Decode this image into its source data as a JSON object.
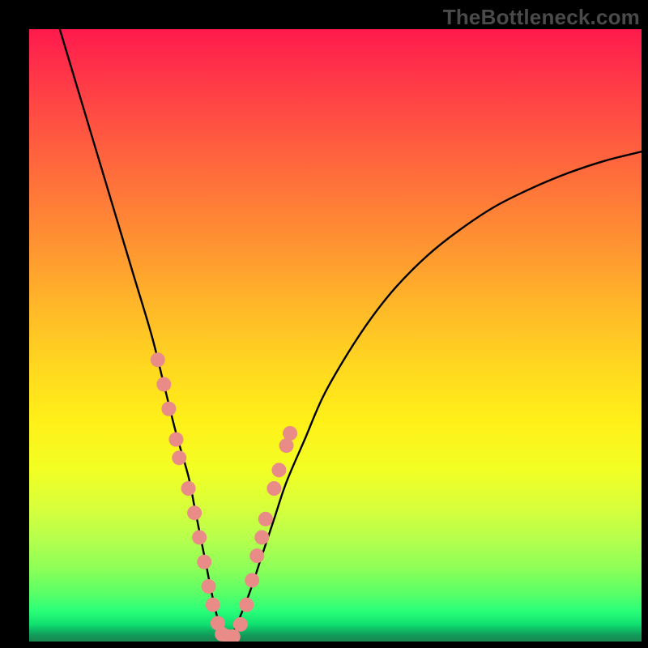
{
  "watermark": "TheBottleneck.com",
  "chart_data": {
    "type": "line",
    "title": "",
    "xlabel": "",
    "ylabel": "",
    "xlim": [
      0,
      100
    ],
    "ylim": [
      0,
      100
    ],
    "grid": false,
    "legend": false,
    "series": [
      {
        "name": "bottleneck-curve",
        "x": [
          5,
          8,
          11,
          14,
          17,
          20,
          22,
          24,
          26,
          27,
          28,
          29,
          30,
          31,
          32,
          33,
          34,
          36,
          38,
          40,
          42,
          45,
          48,
          52,
          56,
          60,
          65,
          70,
          76,
          82,
          88,
          94,
          100
        ],
        "y": [
          100,
          90,
          80,
          70,
          60,
          50,
          42,
          34,
          27,
          22,
          17,
          12,
          7,
          3,
          1,
          1,
          3,
          8,
          14,
          20,
          26,
          33,
          40,
          47,
          53,
          58,
          63,
          67,
          71,
          74,
          76.5,
          78.5,
          80
        ]
      }
    ],
    "markers": {
      "name": "highlight-dots",
      "color": "#e98b86",
      "radius_px": 9,
      "points": [
        {
          "x": 21.0,
          "y": 46
        },
        {
          "x": 22.0,
          "y": 42
        },
        {
          "x": 22.8,
          "y": 38
        },
        {
          "x": 24.0,
          "y": 33
        },
        {
          "x": 24.5,
          "y": 30
        },
        {
          "x": 26.0,
          "y": 25
        },
        {
          "x": 27.0,
          "y": 21
        },
        {
          "x": 27.8,
          "y": 17
        },
        {
          "x": 28.6,
          "y": 13
        },
        {
          "x": 29.3,
          "y": 9
        },
        {
          "x": 30.0,
          "y": 6
        },
        {
          "x": 30.8,
          "y": 3
        },
        {
          "x": 31.5,
          "y": 1.2
        },
        {
          "x": 32.5,
          "y": 0.8
        },
        {
          "x": 33.3,
          "y": 0.8
        },
        {
          "x": 34.5,
          "y": 2.8
        },
        {
          "x": 35.5,
          "y": 6
        },
        {
          "x": 36.4,
          "y": 10
        },
        {
          "x": 37.2,
          "y": 14
        },
        {
          "x": 38.0,
          "y": 17
        },
        {
          "x": 38.6,
          "y": 20
        },
        {
          "x": 40.0,
          "y": 25
        },
        {
          "x": 40.8,
          "y": 28
        },
        {
          "x": 42.0,
          "y": 32
        },
        {
          "x": 42.6,
          "y": 34
        }
      ]
    },
    "background_gradient": {
      "orientation": "vertical",
      "stops": [
        {
          "pct": 0,
          "color": "#ff1a4d"
        },
        {
          "pct": 50,
          "color": "#ffd040"
        },
        {
          "pct": 78,
          "color": "#f4ff30"
        },
        {
          "pct": 100,
          "color": "#17864f"
        }
      ]
    }
  }
}
